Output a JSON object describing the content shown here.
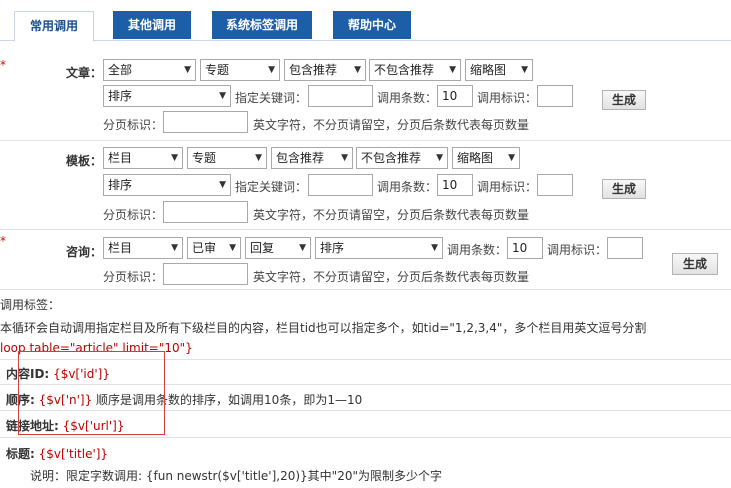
{
  "tabs": [
    {
      "label": "常用调用",
      "active": true
    },
    {
      "label": "其他调用",
      "active": false
    },
    {
      "label": "系统标签调用",
      "active": false
    },
    {
      "label": "帮助中心",
      "active": false
    }
  ],
  "article": {
    "label": "文章：",
    "selects": [
      "全部",
      "专题",
      "包含推荐",
      "不包含推荐",
      "缩略图",
      "排序"
    ],
    "keyword_label": "指定关键词：",
    "count_label": "调用条数：",
    "count_value": "10",
    "tag_label": "调用标识：",
    "tag_value": "",
    "generate": "生成",
    "page_label": "分页标识：",
    "page_note": "英文字符，不分页请留空，分页后条数代表每页数量"
  },
  "template": {
    "label": "模板：",
    "selects": [
      "栏目",
      "专题",
      "包含推荐",
      "不包含推荐",
      "缩略图",
      "排序"
    ],
    "keyword_label": "指定关键词：",
    "count_label": "调用条数：",
    "count_value": "10",
    "tag_label": "调用标识：",
    "generate": "生成",
    "page_label": "分页标识：",
    "page_note": "英文字符，不分页请留空，分页后条数代表每页数量"
  },
  "consult": {
    "label": "咨询：",
    "selects": [
      "栏目",
      "已审",
      "回复",
      "排序"
    ],
    "count_label": "调用条数：",
    "count_value": "10",
    "tag_label": "调用标识：",
    "generate": "生成",
    "page_label": "分页标识：",
    "page_note": "英文字符，不分页请留空，分页后条数代表每页数量"
  },
  "marks": [
    "*",
    "*",
    "*"
  ],
  "help": {
    "title": "调用标签：",
    "desc": "本循环会自动调用指定栏目及所有下级栏目的内容，栏目tid也可以指定多个，如tid=\"1,2,3,4\"，多个栏目用英文逗号分割",
    "loop": "loop table=\"article\" limit=\"10\"}",
    "rows": [
      {
        "label": "内容ID:",
        "code": "{$v['id']}",
        "note": ""
      },
      {
        "label": "顺序:",
        "code": "{$v['n']}",
        "note": "顺序是调用条数的排序，如调用10条，即为1—10"
      },
      {
        "label": "链接地址:",
        "code": "{$v['url']}",
        "note": ""
      },
      {
        "label": "标题:",
        "code": "{$v['title']}",
        "note": ""
      }
    ],
    "title_note": "说明：限定字数调用: {fun newstr($v['title'],20)}其中\"20\"为限制多少个字"
  }
}
